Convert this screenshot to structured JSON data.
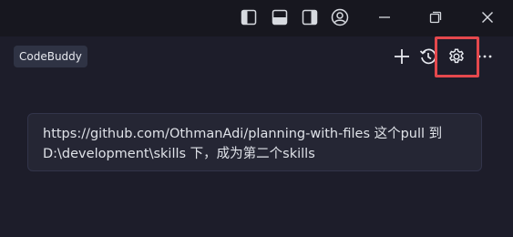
{
  "titlebar": {
    "icons": [
      "toggle-primary-sidebar-icon",
      "toggle-panel-icon",
      "toggle-secondary-sidebar-icon",
      "account-icon",
      "minimize-icon",
      "restore-icon",
      "close-icon"
    ]
  },
  "header": {
    "brand": "CodeBuddy",
    "icons": [
      "add-icon",
      "history-icon",
      "gear-icon",
      "more-icon"
    ],
    "highlight_color": "#e5484d"
  },
  "chat": {
    "user_message": "https://github.com/OthmanAdi/planning-with-files 这个pull 到 D:\\development\\skills 下，成为第二个skills"
  },
  "colors": {
    "background": "#1d1d2a",
    "titlebar": "#17171f",
    "message_bg": "#252634",
    "text": "#dfe2e8"
  }
}
